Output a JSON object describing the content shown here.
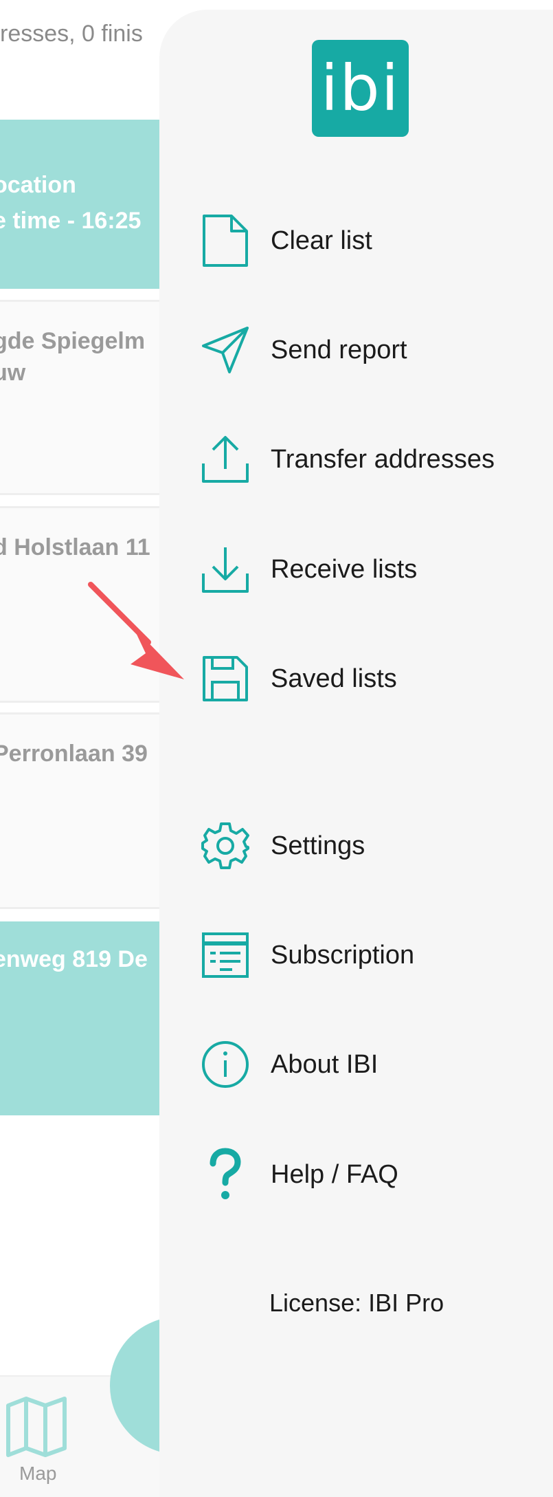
{
  "background": {
    "summary": "resses, 0 finis",
    "cards": [
      {
        "style": "active",
        "lines": [
          "ocation",
          "e time - 16:25"
        ]
      },
      {
        "style": "plain",
        "lines": [
          "gde Spiegelm",
          "uw"
        ]
      },
      {
        "style": "plain",
        "lines": [
          "d Holstlaan 11"
        ]
      },
      {
        "style": "plain",
        "lines": [
          "Perronlaan 39"
        ]
      },
      {
        "style": "active",
        "lines": [
          "enweg 819 De"
        ]
      }
    ],
    "bottom_nav": {
      "map_label": "Map"
    }
  },
  "drawer": {
    "logo_text": "ibi",
    "menu": [
      {
        "label": "Clear list",
        "icon": "file-icon"
      },
      {
        "label": "Send report",
        "icon": "send-icon"
      },
      {
        "label": "Transfer addresses",
        "icon": "upload-icon"
      },
      {
        "label": "Receive lists",
        "icon": "download-icon"
      },
      {
        "label": "Saved lists",
        "icon": "save-icon"
      },
      {
        "label": "Settings",
        "icon": "gear-icon"
      },
      {
        "label": "Subscription",
        "icon": "list-card-icon"
      },
      {
        "label": "About IBI",
        "icon": "info-icon"
      },
      {
        "label": "Help / FAQ",
        "icon": "question-icon"
      }
    ],
    "license": "License: IBI Pro"
  },
  "colors": {
    "accent": "#17aaa4",
    "card_active": "#9fded9",
    "drawer_bg": "#f6f6f6",
    "arrow": "#f0555a"
  }
}
